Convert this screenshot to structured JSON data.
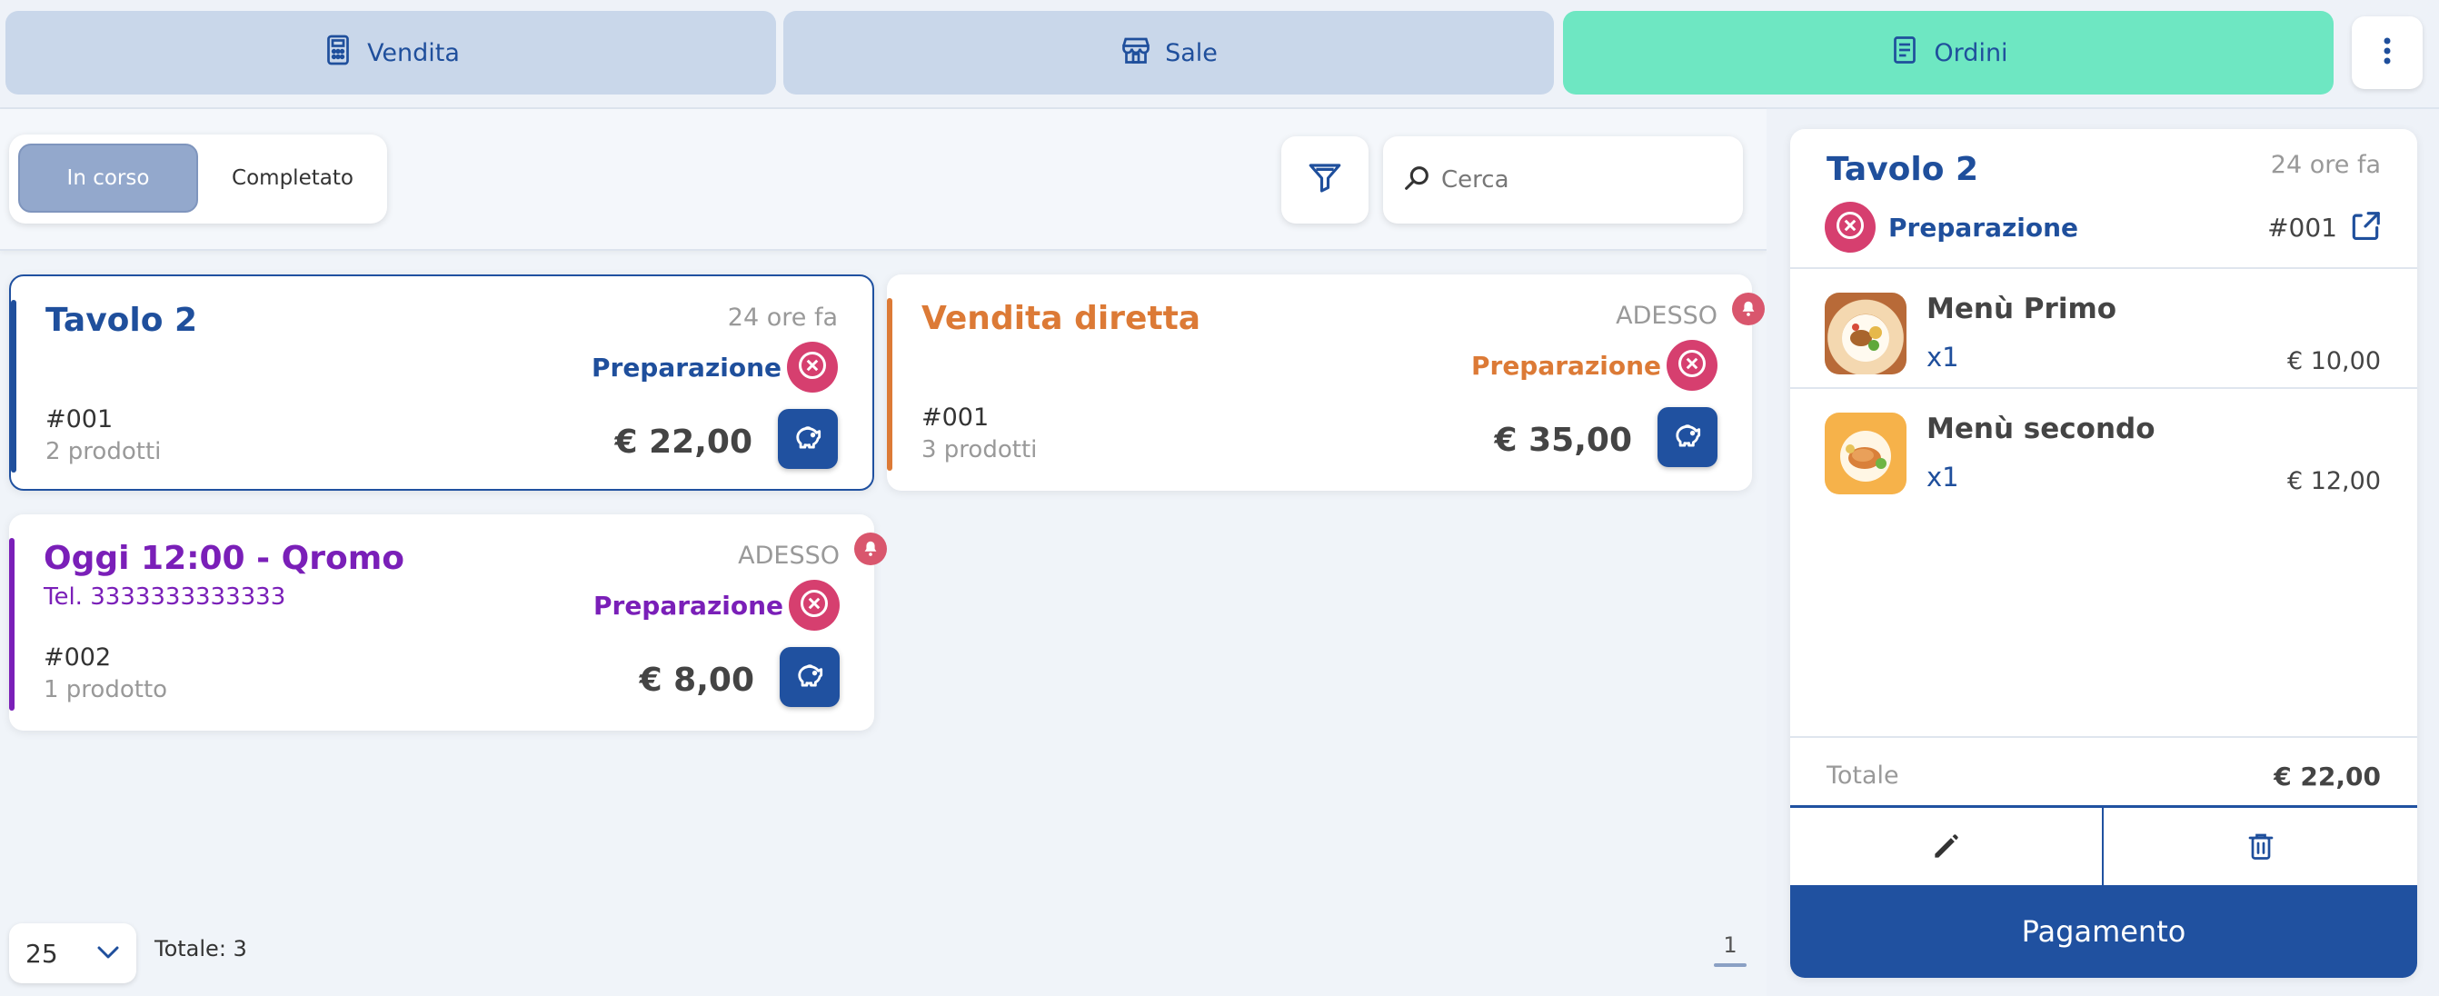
{
  "nav": {
    "tabs": [
      {
        "label": "Vendita",
        "icon": "calculator-icon"
      },
      {
        "label": "Sale",
        "icon": "store-icon"
      },
      {
        "label": "Ordini",
        "icon": "receipt-icon"
      }
    ],
    "active_tab": "Ordini",
    "menu_icon": "dots-vertical-icon"
  },
  "toolbar": {
    "segments": [
      "In corso",
      "Completato"
    ],
    "active_segment": "In corso",
    "filter_icon": "filter-icon",
    "search_placeholder": "Cerca"
  },
  "orders": [
    {
      "title": "Tavolo 2",
      "time": "24 ore fa",
      "phone": "",
      "status": "Preparazione",
      "number": "#001",
      "count": "2 prodotti",
      "price": "€ 22,00",
      "accent": "#1f4f9c",
      "selected": true,
      "notification": false
    },
    {
      "title": "Vendita diretta",
      "time": "ADESSO",
      "phone": "",
      "status": "Preparazione",
      "number": "#001",
      "count": "3 prodotti",
      "price": "€ 35,00",
      "accent": "#dc7a36",
      "selected": false,
      "notification": true
    },
    {
      "title": "Oggi 12:00 - Qromo",
      "time": "ADESSO",
      "phone": "Tel. 3333333333333",
      "status": "Preparazione",
      "number": "#002",
      "count": "1 prodotto",
      "price": "€ 8,00",
      "accent": "#7a1fb8",
      "selected": false,
      "notification": true
    }
  ],
  "pagination": {
    "page_size": "25",
    "total": "Totale: 3",
    "current_page": "1"
  },
  "detail": {
    "title": "Tavolo 2",
    "time": "24 ore fa",
    "status": "Preparazione",
    "number": "#001",
    "items": [
      {
        "name": "Menù Primo",
        "qty": "x1",
        "price": "€ 10,00"
      },
      {
        "name": "Menù secondo",
        "qty": "x1",
        "price": "€ 12,00"
      }
    ],
    "total_label": "Totale",
    "total_value": "€ 22,00",
    "pay_label": "Pagamento"
  },
  "colors": {
    "primary": "#2051a0",
    "active_tab": "#6ee7c2",
    "status_red": "#d63f6f",
    "bell": "#d9566d"
  }
}
